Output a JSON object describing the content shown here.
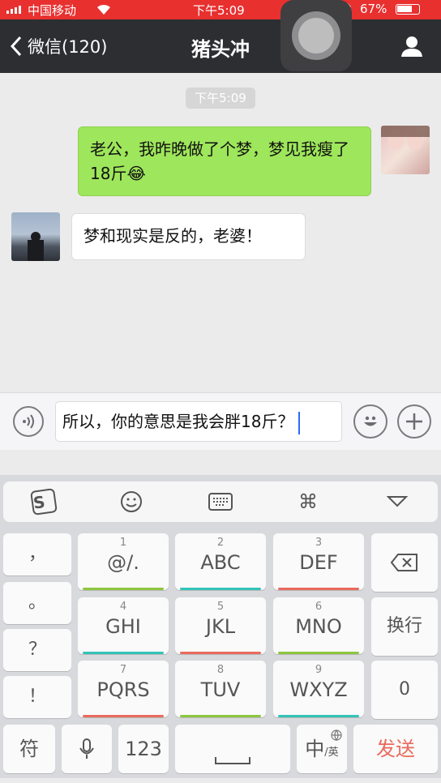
{
  "status_bar": {
    "carrier": "中国移动",
    "time": "下午5:09",
    "battery": "67%"
  },
  "nav": {
    "back_label": "微信(120)",
    "title": "猪头冲"
  },
  "chat": {
    "timestamp": "下午5:09",
    "messages": [
      {
        "side": "sent",
        "text": "老公，我昨晚做了个梦，梦见我瘦了18斤",
        "emoji": "😂"
      },
      {
        "side": "received",
        "text": "梦和现实是反的，老婆！"
      }
    ]
  },
  "input": {
    "value": "所以，你的意思是我会胖18斤？"
  },
  "keyboard": {
    "punct_keys": [
      "，",
      "。",
      "？",
      "！"
    ],
    "keys": [
      {
        "num": "1",
        "label": "@/.",
        "color": "#8cc63f"
      },
      {
        "num": "2",
        "label": "ABC",
        "color": "#34c3b8"
      },
      {
        "num": "3",
        "label": "DEF",
        "color": "#e96a5d"
      },
      {
        "num": "4",
        "label": "GHI",
        "color": "#34c3b8"
      },
      {
        "num": "5",
        "label": "JKL",
        "color": "#e96a5d"
      },
      {
        "num": "6",
        "label": "MNO",
        "color": "#8cc63f"
      },
      {
        "num": "7",
        "label": "PQRS",
        "color": "#e96a5d"
      },
      {
        "num": "8",
        "label": "TUV",
        "color": "#8cc63f"
      },
      {
        "num": "9",
        "label": "WXYZ",
        "color": "#34c3b8"
      }
    ],
    "side_keys": {
      "newline": "换行",
      "zero": "0"
    },
    "bottom": {
      "symbols": "符",
      "number_mode": "123",
      "lang_main": "中",
      "lang_sub": "/英",
      "send": "发送"
    }
  },
  "colors": {
    "status_bar": "#e8302f",
    "nav_bar": "#2d2e32",
    "sent_bubble": "#9ee65b",
    "send_text": "#e96a5d"
  }
}
